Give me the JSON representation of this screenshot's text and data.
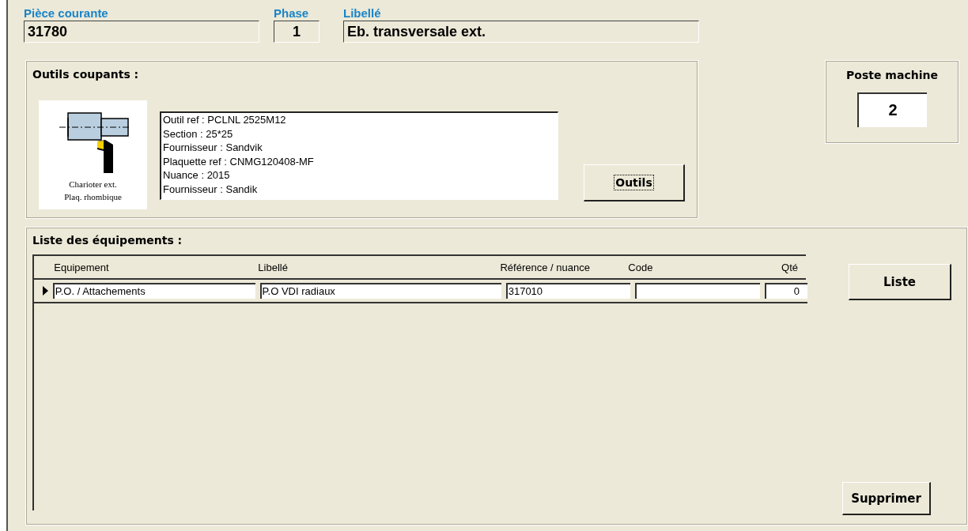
{
  "header": {
    "fields": [
      {
        "label": "Pièce courante",
        "value": "31780",
        "kind": "wide"
      },
      {
        "label": "Phase",
        "value": "1",
        "kind": "narrow"
      },
      {
        "label": "Libellé",
        "value": "Eb. transversale ext.",
        "kind": "wide"
      }
    ]
  },
  "tools": {
    "title": "Outils coupants :",
    "caption": [
      "Charioter ext.",
      "Plaq. rhombique"
    ],
    "details": [
      "Outil ref : PCLNL 2525M12",
      "Section : 25*25",
      "Fournisseur : Sandvik",
      "Plaquette ref : CNMG120408-MF",
      "Nuance : 2015",
      "Fournisseur : Sandik"
    ],
    "button": "Outils"
  },
  "machine": {
    "title": "Poste machine",
    "value": "2"
  },
  "equipment": {
    "title": "Liste des équipements :",
    "columns": [
      "Equipement",
      "Libellé",
      "Référence / nuance",
      "Code",
      "Qté"
    ],
    "rows": [
      {
        "current": true,
        "cells": [
          "P.O. / Attachements",
          "P.O VDI radiaux",
          "317010",
          "",
          "0"
        ]
      }
    ],
    "buttons": [
      "Liste",
      "Supprimer"
    ]
  }
}
